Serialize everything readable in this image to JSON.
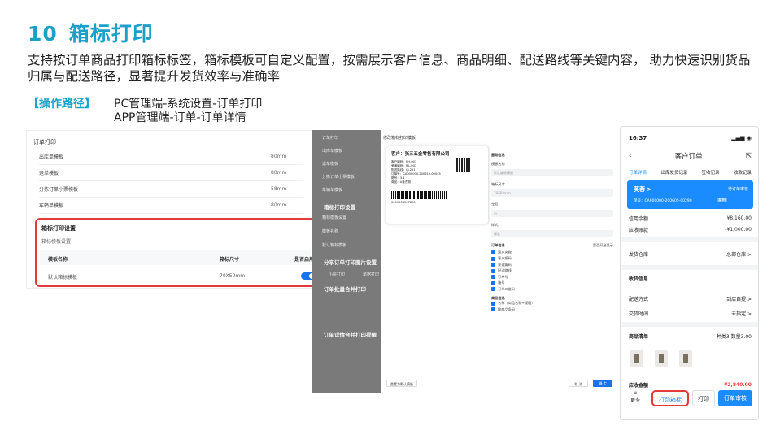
{
  "header": {
    "num": "10",
    "title": "箱标打印"
  },
  "description": "支持按订单商品打印箱标标签，箱标模板可自定义配置，按需展示客户信息、商品明细、配送路线等关键内容， 助力快速识别货品归属与配送路径，显著提升发货效率与准确率",
  "path": {
    "tag": "【操作路径】",
    "line1": "PC管理端-系统设置-订单打印",
    "line2": "APP管理端-订单-订单详情"
  },
  "panel1": {
    "title": "订单打印",
    "rows": [
      {
        "name": "出库单模板",
        "size": "80mm"
      },
      {
        "name": "退单模板",
        "size": "80mm"
      },
      {
        "name": "分拣订单小票模板",
        "size": "58mm"
      },
      {
        "name": "车辆单模板",
        "size": "80mm"
      }
    ],
    "box_title": "箱标打印设置",
    "box_sub": "箱标模板设置",
    "col_name": "模板名称",
    "col_size": "箱标尺寸",
    "col_enable": "是否启用",
    "tpl_name": "默认箱标模板",
    "tpl_size": "70X50mm"
  },
  "panel2": {
    "side": [
      "订单打印",
      "出库单模板",
      "退单模板",
      "分拣订单小票模板",
      "车辆单模板"
    ],
    "side_bold1": "箱标打印设置",
    "side_sub1": "箱标模板设置",
    "side_item1": "模板名称",
    "side_item2": "默认箱标模板",
    "side_bold2": "分享订单打印图片设置",
    "side_opt1": "小票打印",
    "side_opt2": "单据打印",
    "side_bold3": "订单批量合并打印",
    "side_bold4": "订单详情合并打印提醒",
    "dialog_title": "修改箱标打印模板",
    "label_company": "客户：张三五金零售有限公司",
    "label_lines": [
      "客户编码：KH-001",
      "荣道编码：ML-001",
      "配送路线：CJ-201",
      "订单号：CA000000-200619-00045",
      "箱号：3-1",
      "商品：A套衣物"
    ],
    "barcode_num": "0001234567890",
    "f_base": "基础信息",
    "f_name": "模板名称",
    "f_name_ph": "默认箱标模板",
    "f_size": "箱标尺寸",
    "f_size_val": "70X50mm",
    "f_font": "字号",
    "f_font_val": "小",
    "f_style": "样式",
    "f_style_val": "标准",
    "f_order": "订单信息",
    "f_toggle": "是否开启显示",
    "f_checks": [
      "客户名称",
      "客户编码",
      "荣道编码",
      "配送路线",
      "订单号",
      "箱号",
      "订单二维码"
    ],
    "f_goods": "商品信息",
    "f_gchecks": [
      "名称（商品名称+规格）",
      "按商品条码"
    ],
    "reset": "重置为默认模板",
    "cancel": "取 消",
    "ok": "确 定"
  },
  "phone": {
    "time": "16:37",
    "title": "客户订单",
    "tabs": [
      "订单详情",
      "出库发货记录",
      "签收记录",
      "收款记录"
    ],
    "card_name": "芙蓉 >",
    "card_status": "待订单审核",
    "card_no": "单号：CA000000-200605-00290",
    "card_copy": "复制",
    "credit_label": "信用余额",
    "credit_val": "¥8,160.00",
    "due_label": "应收账款",
    "due_val": "-¥1,000.00",
    "wh_label": "发货仓库",
    "wh_val": "总部仓库 >",
    "recv": "收货信息",
    "ship_label": "配送方式",
    "ship_val": "到店自提 >",
    "time_label": "交货时间",
    "time_val": "未指定 >",
    "list_label": "商品清单",
    "list_val": "种类3,数量3.00",
    "total_label": "应收金额",
    "total_val": "¥2,840.00",
    "more": "更多",
    "btn1": "打印箱标",
    "btn2": "打印",
    "btn3": "订单审核"
  }
}
